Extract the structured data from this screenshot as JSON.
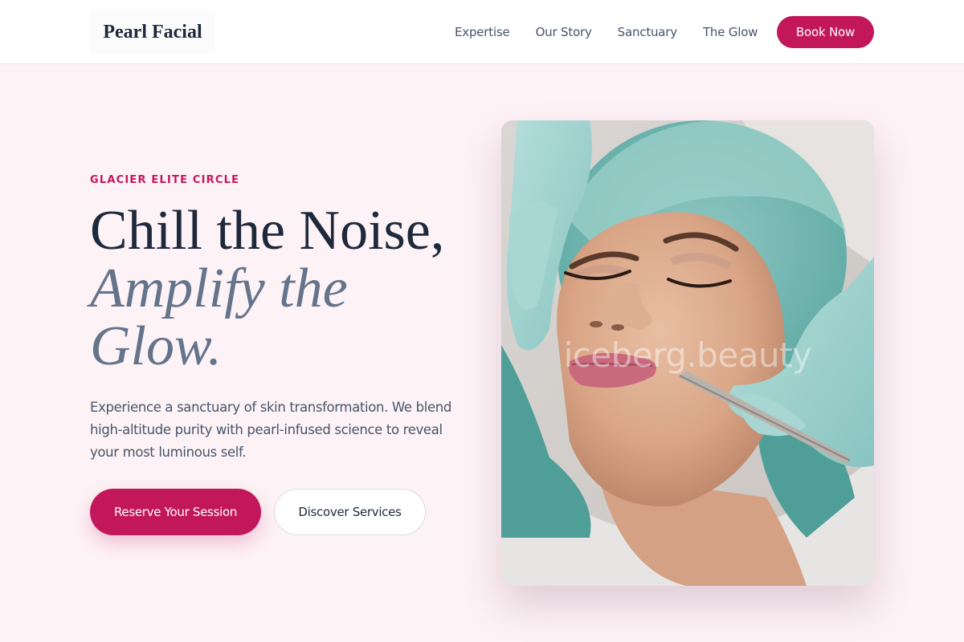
{
  "brand": {
    "logo_text": "Pearl Facial"
  },
  "nav": {
    "items": [
      {
        "label": "Expertise"
      },
      {
        "label": "Our Story"
      },
      {
        "label": "Sanctuary"
      },
      {
        "label": "The Glow"
      }
    ],
    "cta_label": "Book Now"
  },
  "hero": {
    "eyebrow": "GLACIER ELITE CIRCLE",
    "headline_line1": "Chill the Noise,",
    "headline_line2": "Amplify the Glow.",
    "description": "Experience a sanctuary of skin transformation. We blend high-altitude purity with pearl-infused science to reveal your most luminous self.",
    "primary_button": "Reserve Your Session",
    "secondary_button": "Discover Services",
    "image_watermark": "iceberg.beauty"
  },
  "colors": {
    "accent": "#c2185b",
    "page_background": "#fdf2f6",
    "heading_dark": "#1e293b",
    "heading_muted": "#64748b"
  }
}
